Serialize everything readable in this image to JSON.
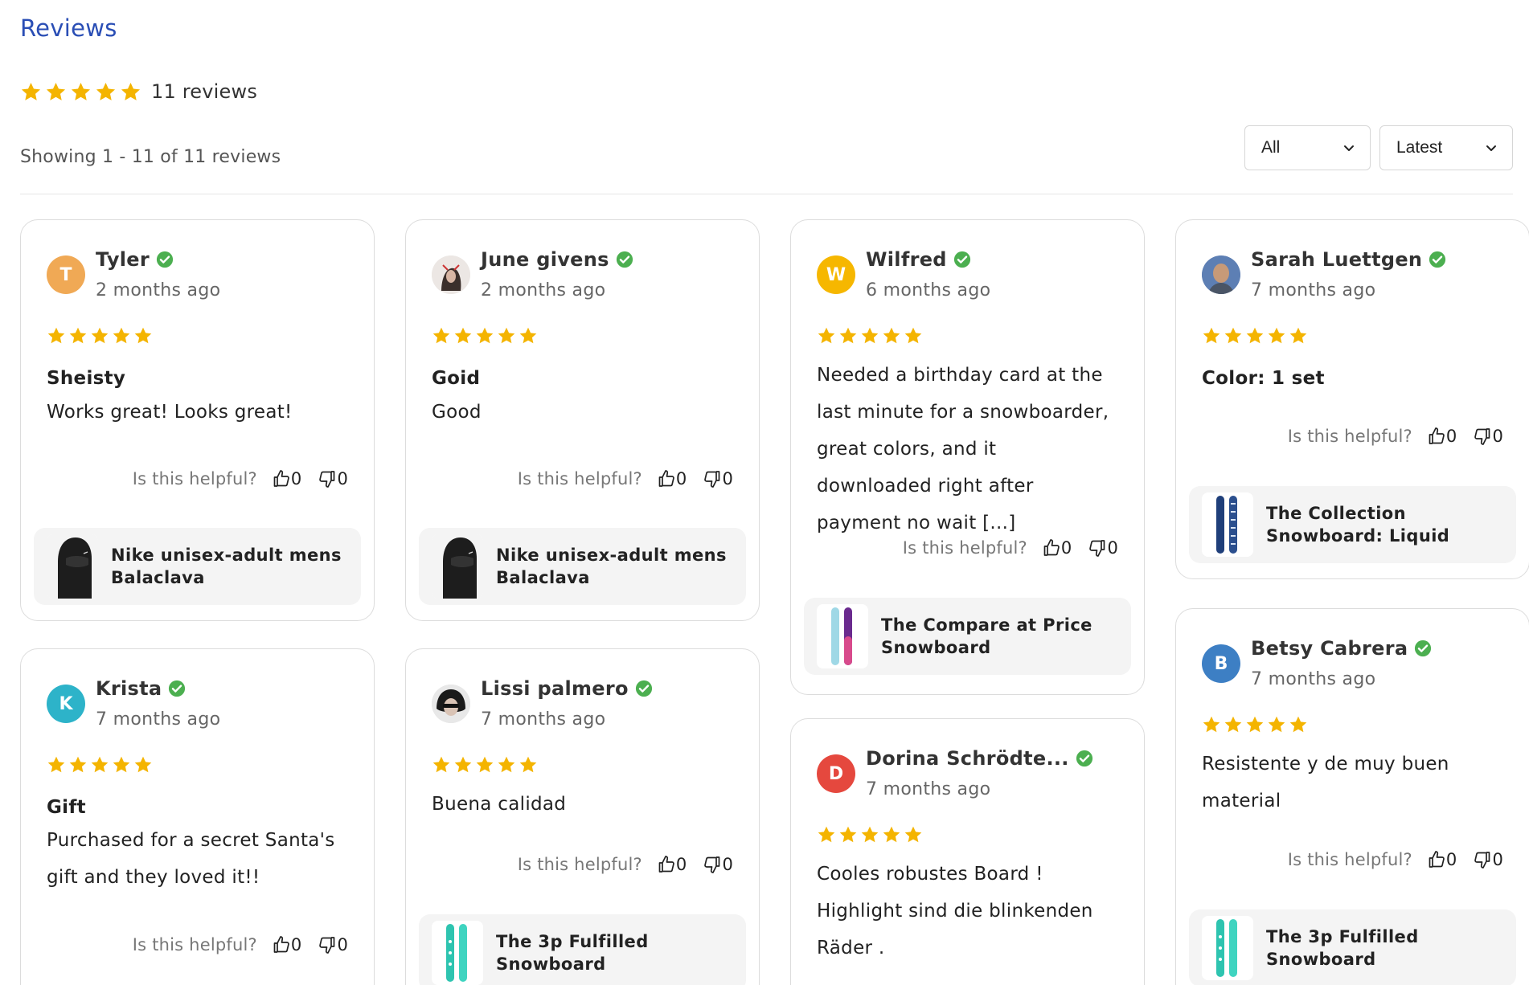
{
  "header": {
    "title": "Reviews",
    "rating": 5,
    "review_count": "11 reviews",
    "showing": "Showing 1 - 11 of 11 reviews"
  },
  "filters": {
    "rating_filter": "All",
    "sort": "Latest"
  },
  "colors": {
    "title": "#2a4eb5",
    "star": "#f4b400",
    "verified": "#4caf50"
  },
  "helpful_label": "Is this helpful?",
  "reviews": [
    {
      "name": "Tyler",
      "initial": "T",
      "avatar_color": "#f0a955",
      "date": "2 months ago",
      "rating": 5,
      "title": "Sheisty",
      "body": "Works great! Looks great!",
      "up": "0",
      "down": "0",
      "product": "Nike unisex-adult mens Balaclava",
      "product_icon": "balaclava-image"
    },
    {
      "name": "June givens",
      "initial": "",
      "avatar_color": "#e9e4e2",
      "date": "2 months ago",
      "rating": 5,
      "title": "Goid",
      "body": "Good",
      "up": "0",
      "down": "0",
      "product": "Nike unisex-adult mens Balaclava",
      "product_icon": "balaclava-image"
    },
    {
      "name": "Wilfred",
      "initial": "W",
      "avatar_color": "#f6b700",
      "date": "6 months ago",
      "rating": 5,
      "title": "",
      "body": "Needed a birthday card at the last minute for a snowboarder, great colors, and it downloaded right after payment no wait [...]",
      "up": "0",
      "down": "0",
      "product": "The Compare at Price Snowboard",
      "product_icon": "snowboard-image"
    },
    {
      "name": "Sarah Luettgen",
      "initial": "",
      "avatar_color": "#6f88b6",
      "date": "7 months ago",
      "rating": 5,
      "title": "Color: 1 set",
      "body": "",
      "up": "0",
      "down": "0",
      "product": "The Collection Snowboard: Liquid",
      "product_icon": "snowboard-image"
    },
    {
      "name": "Krista",
      "initial": "K",
      "avatar_color": "#2db3c9",
      "date": "7 months ago",
      "rating": 5,
      "title": "Gift",
      "body": "Purchased for a secret Santa's gift and they loved it!!",
      "up": "0",
      "down": "0",
      "product": "",
      "product_icon": ""
    },
    {
      "name": "Lissi palmero",
      "initial": "",
      "avatar_color": "#dddddd",
      "date": "7 months ago",
      "rating": 5,
      "title": "",
      "body": "Buena calidad",
      "up": "0",
      "down": "0",
      "product": "The 3p Fulfilled Snowboard",
      "product_icon": "snowboard-image"
    },
    {
      "name": "Dorina Schrödte...",
      "initial": "D",
      "avatar_color": "#e5483e",
      "date": "7 months ago",
      "rating": 5,
      "title": "",
      "body": "Cooles robustes Board ! Highlight sind die blinkenden Räder .",
      "up": "",
      "down": "",
      "product": "",
      "product_icon": ""
    },
    {
      "name": "Betsy Cabrera",
      "initial": "B",
      "avatar_color": "#3d7fc4",
      "date": "7 months ago",
      "rating": 5,
      "title": "",
      "body": "Resistente y de muy buen material",
      "up": "0",
      "down": "0",
      "product": "The 3p Fulfilled Snowboard",
      "product_icon": "snowboard-image"
    }
  ]
}
